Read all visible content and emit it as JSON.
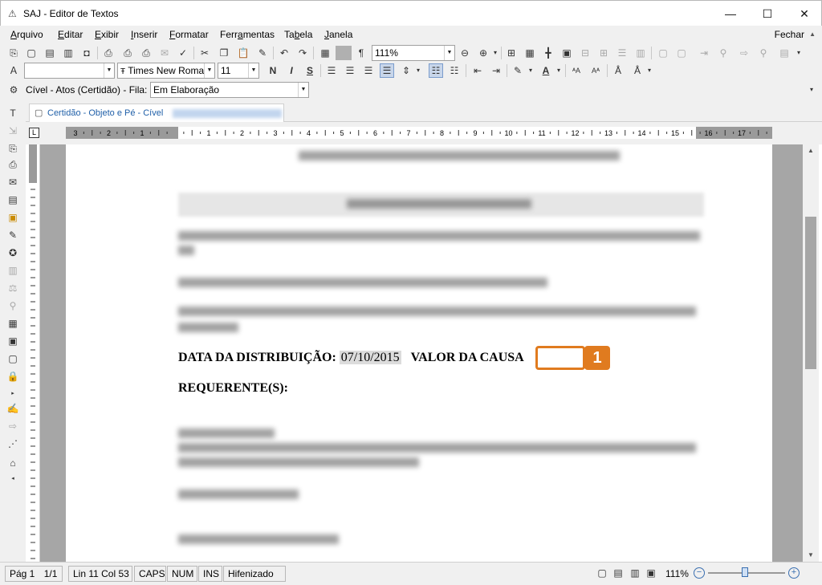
{
  "window": {
    "title": "SAJ - Editor de Textos",
    "minimize": "—",
    "maximize": "☐",
    "close": "✕"
  },
  "menu": {
    "items": [
      {
        "accel": "A",
        "rest": "rquivo"
      },
      {
        "accel": "E",
        "rest": "ditar"
      },
      {
        "accel": "E",
        "rest": "xibir"
      },
      {
        "accel": "I",
        "rest": "nserir"
      },
      {
        "accel": "F",
        "rest": "ormatar"
      },
      {
        "pre": "Ferr",
        "accel": "a",
        "rest": "mentas"
      },
      {
        "pre": "Ta",
        "accel": "b",
        "rest": "ela"
      },
      {
        "accel": "J",
        "rest": "anela"
      }
    ],
    "fechar": "Fechar"
  },
  "toolbar": {
    "zoom_value": "111%",
    "font_name": "Times New Roman",
    "font_size": "11",
    "bold": "N",
    "italic": "I",
    "strike": "S"
  },
  "fila": {
    "label": "Cível - Atos (Certidão) - Fila:",
    "value": "Em Elaboração"
  },
  "tab": {
    "label": "Certidão - Objeto e Pé - Cível"
  },
  "ruler": {
    "numbers": [
      "3",
      "2",
      "1",
      "",
      "1",
      "2",
      "3",
      "4",
      "5",
      "6",
      "7",
      "8",
      "9",
      "10",
      "11",
      "12",
      "13",
      "14",
      "15",
      "16",
      "17"
    ]
  },
  "document": {
    "data_label": "DATA DA DISTRIBUIÇÃO:",
    "data_value": "07/10/2015",
    "valor_label": "VALOR DA CAUSA",
    "field_number": "1",
    "requerentes": "REQUERENTE(S):"
  },
  "status": {
    "page": "Pág 1",
    "pages": "1/1",
    "line_col": "Lin 11  Col 53",
    "caps": "CAPS",
    "num": "NUM",
    "ins": "INS",
    "hifen": "Hifenizado",
    "zoom": "111%"
  },
  "colors": {
    "accent": "#e07b1f",
    "tab_text": "#1f5fa8"
  }
}
